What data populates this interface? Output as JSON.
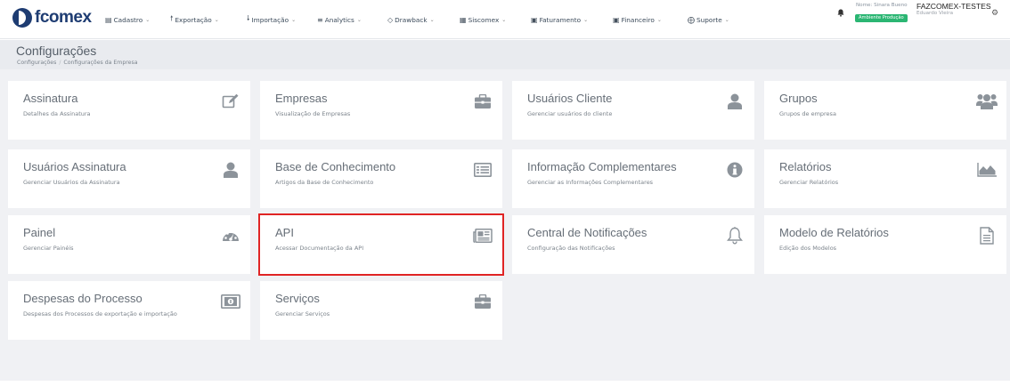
{
  "brand": {
    "name": "fcomex"
  },
  "menu": [
    {
      "label": "Cadastro",
      "icon": "list-icon"
    },
    {
      "label": "Exportação",
      "icon": "arrow-up-icon"
    },
    {
      "label": "Importação",
      "icon": "arrow-down-icon"
    },
    {
      "label": "Analytics",
      "icon": "bars-icon"
    },
    {
      "label": "Drawback",
      "icon": "diamond-icon"
    },
    {
      "label": "Siscomex",
      "icon": "grid-icon"
    },
    {
      "label": "Faturamento",
      "icon": "dollar-icon"
    },
    {
      "label": "Financeiro",
      "icon": "dollar-icon"
    },
    {
      "label": "Suporte",
      "icon": "lifebuoy-icon"
    }
  ],
  "user": {
    "name_label": "Nome: Sinara Bueno",
    "company": "FAZCOMEX-TESTES",
    "subtitle": "Eduardo Vieira",
    "environment": "Ambiente Produção"
  },
  "page": {
    "title": "Configurações",
    "breadcrumb": [
      "Configurações",
      "Configurações da Empresa"
    ]
  },
  "cards": [
    {
      "title": "Assinatura",
      "desc": "Detalhes da Assinatura",
      "icon": "edit-icon"
    },
    {
      "title": "Empresas",
      "desc": "Visualização de Empresas",
      "icon": "briefcase-icon"
    },
    {
      "title": "Usuários Cliente",
      "desc": "Gerenciar usuários do cliente",
      "icon": "user-icon"
    },
    {
      "title": "Grupos",
      "desc": "Grupos de empresa",
      "icon": "users-icon"
    },
    {
      "title": "Usuários Assinatura",
      "desc": "Gerenciar Usuários da Assinatura",
      "icon": "user-icon"
    },
    {
      "title": "Base de Conhecimento",
      "desc": "Artigos da Base de Conhecimento",
      "icon": "list-alt-icon"
    },
    {
      "title": "Informação Complementares",
      "desc": "Gerenciar as Informações Complementares",
      "icon": "info-icon"
    },
    {
      "title": "Relatórios",
      "desc": "Gerenciar Relatórios",
      "icon": "area-chart-icon"
    },
    {
      "title": "Painel",
      "desc": "Gerenciar Painéis",
      "icon": "dashboard-icon"
    },
    {
      "title": "API",
      "desc": "Acessar Documentação da API",
      "icon": "newspaper-icon",
      "highlighted": true
    },
    {
      "title": "Central de Notificações",
      "desc": "Configuração das Notificações",
      "icon": "bell-icon"
    },
    {
      "title": "Modelo de Relatórios",
      "desc": "Edição dos Modelos",
      "icon": "file-text-icon"
    },
    {
      "title": "Despesas do Processo",
      "desc": "Despesas dos Processos de exportação e importação",
      "icon": "money-icon"
    },
    {
      "title": "Serviços",
      "desc": "Gerenciar Serviços",
      "icon": "briefcase-icon"
    }
  ],
  "colors": {
    "brand": "#1e3c72",
    "highlight": "#e02424",
    "badge": "#2bb673",
    "background": "#f0f1f4",
    "icon": "#8c939a"
  }
}
